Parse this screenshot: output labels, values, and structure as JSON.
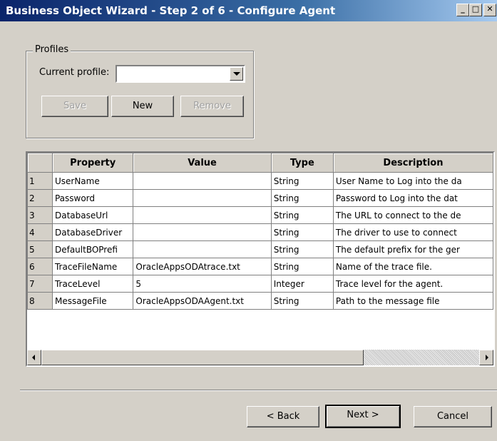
{
  "window": {
    "title": "Business Object Wizard - Step 2 of 6 - Configure Agent",
    "controls": [
      "minimize-icon",
      "maximize-icon",
      "close-icon"
    ]
  },
  "profiles": {
    "group_title": "Profiles",
    "current_profile_label": "Current profile:",
    "current_profile_value": "",
    "save_label": "Save",
    "new_label": "New",
    "remove_label": "Remove"
  },
  "grid": {
    "headers": [
      "",
      "Property",
      "Value",
      "Type",
      "Description"
    ],
    "rows": [
      {
        "num": "1",
        "property": "UserName",
        "value": "",
        "type": "String",
        "description": "User Name to Log into the da"
      },
      {
        "num": "2",
        "property": "Password",
        "value": "",
        "type": "String",
        "description": "Password to Log into the dat"
      },
      {
        "num": "3",
        "property": "DatabaseUrl",
        "value": "",
        "type": "String",
        "description": "The URL to connect to the de"
      },
      {
        "num": "4",
        "property": "DatabaseDriver",
        "value": "",
        "type": "String",
        "description": "The driver to use to connect"
      },
      {
        "num": "5",
        "property": "DefaultBOPrefi",
        "value": "",
        "type": "String",
        "description": "The default prefix for the ger"
      },
      {
        "num": "6",
        "property": "TraceFileName",
        "value": "OracleAppsODAtrace.txt",
        "type": "String",
        "description": "Name of the trace file."
      },
      {
        "num": "7",
        "property": "TraceLevel",
        "value": "5",
        "type": "Integer",
        "description": "Trace level for the agent."
      },
      {
        "num": "8",
        "property": "MessageFile",
        "value": "OracleAppsODAAgent.txt",
        "type": "String",
        "description": "Path to the message file"
      }
    ]
  },
  "footer": {
    "back_label": "< Back",
    "next_label": "Next >",
    "cancel_label": "Cancel"
  }
}
